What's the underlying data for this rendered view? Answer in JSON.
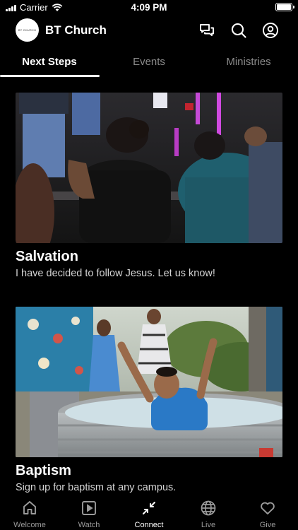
{
  "status_bar": {
    "carrier": "Carrier",
    "time": "4:09 PM",
    "wifi_icon": "wifi-icon",
    "battery_icon": "battery-icon"
  },
  "header": {
    "logo_text": "BT CHURCH",
    "title": "BT Church",
    "icons": [
      "chat-icon",
      "search-icon",
      "profile-icon"
    ]
  },
  "tabs": [
    {
      "label": "Next Steps",
      "active": true
    },
    {
      "label": "Events",
      "active": false
    },
    {
      "label": "Ministries",
      "active": false
    }
  ],
  "cards": [
    {
      "title": "Salvation",
      "description": "I have decided to follow Jesus. Let us know!",
      "image": "prayer-photo"
    },
    {
      "title": "Baptism",
      "description": "Sign up for baptism at any campus.",
      "image": "baptism-photo"
    }
  ],
  "nav": [
    {
      "label": "Welcome",
      "icon": "home-icon",
      "active": false
    },
    {
      "label": "Watch",
      "icon": "play-icon",
      "active": false
    },
    {
      "label": "Connect",
      "icon": "connect-icon",
      "active": true
    },
    {
      "label": "Live",
      "icon": "globe-icon",
      "active": false
    },
    {
      "label": "Give",
      "icon": "heart-icon",
      "active": false
    }
  ],
  "colors": {
    "background": "#000000",
    "text": "#ffffff",
    "inactive": "#8a8a8a"
  }
}
